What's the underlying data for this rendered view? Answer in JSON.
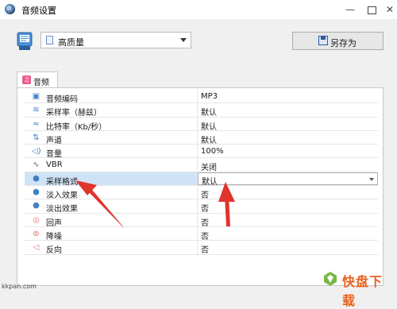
{
  "window": {
    "title": "音频设置",
    "controls": {
      "minimize": "—",
      "close": "✕"
    }
  },
  "toolbar": {
    "preset_value": "高质量",
    "save_as_label": "另存为"
  },
  "tabs": [
    {
      "label": "音频",
      "icon": "music-icon"
    }
  ],
  "properties": [
    {
      "label": "音频编码",
      "value": "MP3",
      "icon": "codec-icon"
    },
    {
      "label": "采样率（赫兹）",
      "value": "默认",
      "icon": "sample-rate-icon"
    },
    {
      "label": "比特率（Kb/秒）",
      "value": "默认",
      "icon": "bitrate-icon"
    },
    {
      "label": "声道",
      "value": "默认",
      "icon": "channel-icon"
    },
    {
      "label": "音量",
      "value": "100%",
      "icon": "volume-icon"
    },
    {
      "label": "VBR",
      "value": "关闭",
      "icon": "vbr-icon"
    },
    {
      "label": "采样格式",
      "value": "默认",
      "icon": "sample-format-icon",
      "selected": true
    },
    {
      "label": "淡入效果",
      "value": "否",
      "icon": "fade-in-icon"
    },
    {
      "label": "淡出效果",
      "value": "否",
      "icon": "fade-out-icon"
    },
    {
      "label": "回声",
      "value": "否",
      "icon": "echo-icon"
    },
    {
      "label": "降噪",
      "value": "否",
      "icon": "denoise-icon"
    },
    {
      "label": "反向",
      "value": "否",
      "icon": "reverse-icon"
    }
  ],
  "watermark": {
    "site": "kkpan.com",
    "brand": "快盘下载"
  },
  "colors": {
    "accent_arrow": "#e0342c",
    "selection": "#cfe3f7",
    "icon_blue": "#3f7fc6",
    "tab_icon": "#ee5d8e"
  }
}
